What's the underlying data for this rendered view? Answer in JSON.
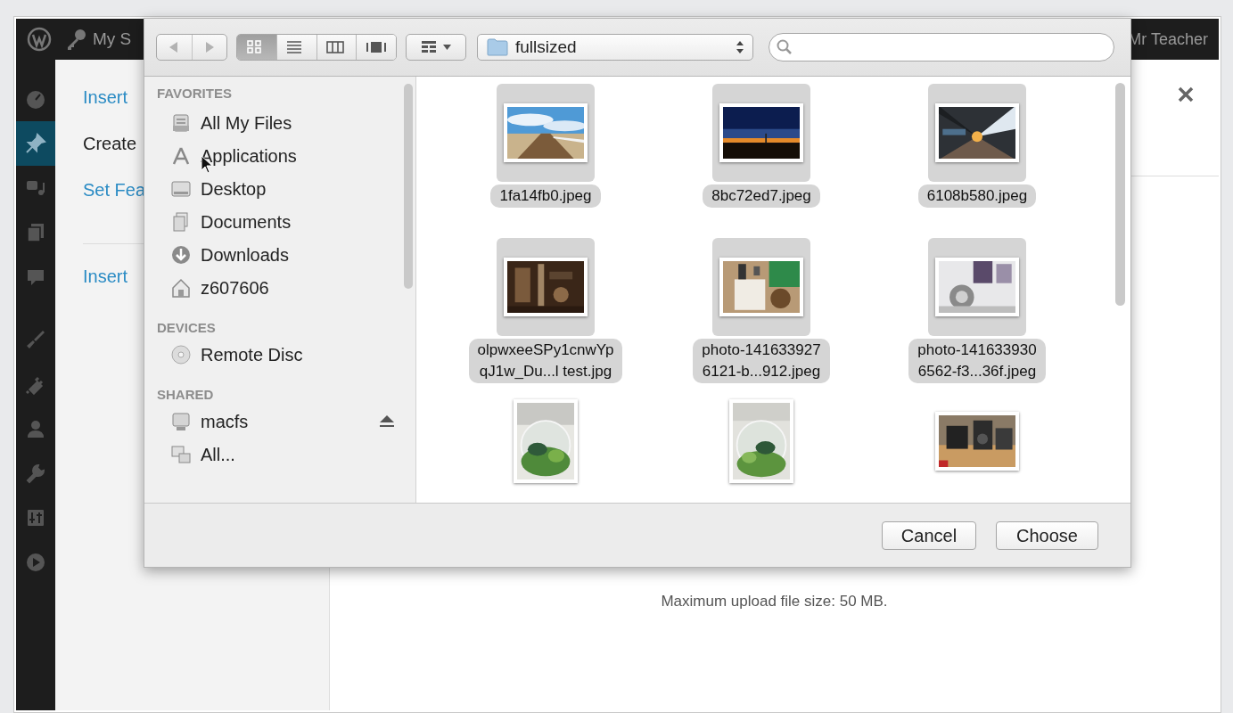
{
  "admin_bar": {
    "site": "My S",
    "user": "Mr Teacher"
  },
  "admin_menu": [
    {
      "kind": "dashboard",
      "selected": false
    },
    {
      "kind": "pin",
      "selected": true
    },
    {
      "kind": "media",
      "selected": false
    },
    {
      "kind": "pages",
      "selected": false
    },
    {
      "kind": "comments",
      "selected": false
    },
    {
      "kind": "brush",
      "selected": false
    },
    {
      "kind": "plug",
      "selected": false
    },
    {
      "kind": "user",
      "selected": false
    },
    {
      "kind": "wrench",
      "selected": false
    },
    {
      "kind": "settings",
      "selected": false
    },
    {
      "kind": "play",
      "selected": false
    }
  ],
  "modal": {
    "links": [
      {
        "text": "Insert",
        "kind": "link"
      },
      {
        "text": "Create",
        "kind": "plain"
      },
      {
        "text": "Set Fea",
        "kind": "link"
      },
      {
        "text": "Insert",
        "kind": "link"
      }
    ],
    "upload_note": "Maximum upload file size: 50 MB."
  },
  "file_dialog": {
    "views": [
      {
        "kind": "icons",
        "selected": true
      },
      {
        "kind": "list",
        "selected": false
      },
      {
        "kind": "columns",
        "selected": false
      },
      {
        "kind": "coverflow",
        "selected": false
      }
    ],
    "location": "fullsized",
    "sidebar": [
      {
        "heading": "FAVORITES",
        "items": [
          {
            "label": "All My Files",
            "kind": "files",
            "ejectable": false
          },
          {
            "label": "Applications",
            "kind": "apps",
            "ejectable": false
          },
          {
            "label": "Desktop",
            "kind": "desktop",
            "ejectable": false
          },
          {
            "label": "Documents",
            "kind": "documents",
            "ejectable": false
          },
          {
            "label": "Downloads",
            "kind": "downloads",
            "ejectable": false
          },
          {
            "label": "z607606",
            "kind": "home",
            "ejectable": false
          }
        ]
      },
      {
        "heading": "DEVICES",
        "items": [
          {
            "label": "Remote Disc",
            "kind": "disc",
            "ejectable": false
          }
        ]
      },
      {
        "heading": "SHARED",
        "items": [
          {
            "label": "macfs",
            "kind": "server",
            "ejectable": true
          },
          {
            "label": "All...",
            "kind": "network",
            "ejectable": false
          }
        ]
      }
    ],
    "files": [
      {
        "name_lines": [
          "1fa14fb0.jpeg"
        ],
        "selected": true,
        "kind": "picture"
      },
      {
        "name_lines": [
          "8bc72ed7.jpeg"
        ],
        "selected": true,
        "kind": "picture"
      },
      {
        "name_lines": [
          "6108b580.jpeg"
        ],
        "selected": true,
        "kind": "picture"
      },
      {
        "name_lines": [
          "olpwxeeSPy1cnwYp",
          "qJ1w_Du...l test.jpg"
        ],
        "selected": true,
        "kind": "picture"
      },
      {
        "name_lines": [
          "photo-141633927",
          "6121-b...912.jpeg"
        ],
        "selected": true,
        "kind": "picture"
      },
      {
        "name_lines": [
          "photo-141633930",
          "6562-f3...36f.jpeg"
        ],
        "selected": true,
        "kind": "picture"
      },
      {
        "selected": false,
        "kind": "picture"
      },
      {
        "selected": false,
        "kind": "picture"
      },
      {
        "selected": false,
        "kind": "picture"
      }
    ],
    "buttons": [
      {
        "label": "Cancel"
      },
      {
        "label": "Choose"
      }
    ]
  }
}
